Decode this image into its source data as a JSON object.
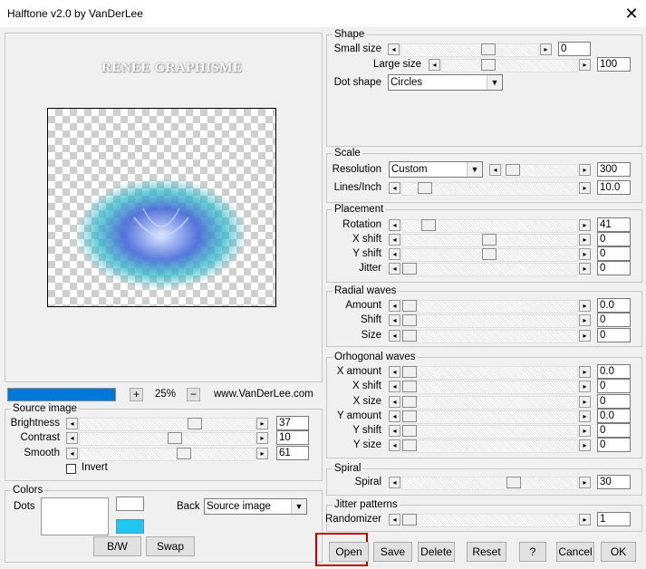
{
  "window": {
    "title": "Halftone v2.0 by VanDerLee",
    "close_icon": "close-icon"
  },
  "preview": {
    "watermark": "RENEE GRAPHISME",
    "zoom": "25%",
    "website": "www.VanDerLee.com",
    "plus": "+",
    "minus": "−",
    "progress": 1.0,
    "accent": "#0078d7"
  },
  "source_image": {
    "title": "Source image",
    "brightness": {
      "label": "Brightness",
      "value": "37"
    },
    "contrast": {
      "label": "Contrast",
      "value": "10"
    },
    "smooth": {
      "label": "Smooth",
      "value": "61"
    },
    "invert": "Invert"
  },
  "colors": {
    "title": "Colors",
    "dots": "Dots",
    "back": "Back",
    "back_value": "Source image",
    "bw": "B/W",
    "swap": "Swap",
    "dot_color": "#ffffff",
    "back_color": "#1ec8f0"
  },
  "shape": {
    "title": "Shape",
    "small_size": {
      "label": "Small size",
      "value": "0"
    },
    "large_size": {
      "label": "Large size",
      "value": "100"
    },
    "dot_shape": {
      "label": "Dot shape",
      "value": "Circles"
    }
  },
  "scale": {
    "title": "Scale",
    "resolution": {
      "label": "Resolution",
      "mode": "Custom",
      "value": "300"
    },
    "lines_inch": {
      "label": "Lines/Inch",
      "value": "10.0"
    }
  },
  "placement": {
    "title": "Placement",
    "rotation": {
      "label": "Rotation",
      "value": "41"
    },
    "x_shift": {
      "label": "X shift",
      "value": "0"
    },
    "y_shift": {
      "label": "Y shift",
      "value": "0"
    },
    "jitter": {
      "label": "Jitter",
      "value": "0"
    }
  },
  "radial_waves": {
    "title": "Radial waves",
    "amount": {
      "label": "Amount",
      "value": "0.0"
    },
    "shift": {
      "label": "Shift",
      "value": "0"
    },
    "size": {
      "label": "Size",
      "value": "0"
    }
  },
  "orthogonal_waves": {
    "title": "Orhogonal waves",
    "x_amount": {
      "label": "X amount",
      "value": "0.0"
    },
    "x_shift": {
      "label": "X shift",
      "value": "0"
    },
    "x_size": {
      "label": "X size",
      "value": "0"
    },
    "y_amount": {
      "label": "Y amount",
      "value": "0.0"
    },
    "y_shift": {
      "label": "Y shift",
      "value": "0"
    },
    "y_size": {
      "label": "Y size",
      "value": "0"
    }
  },
  "spiral": {
    "title": "Spiral",
    "spiral": {
      "label": "Spiral",
      "value": "30"
    }
  },
  "jitter_patterns": {
    "title": "Jitter patterns",
    "randomizer": {
      "label": "Randomizer",
      "value": "1"
    }
  },
  "buttons": {
    "open": "Open",
    "save": "Save",
    "delete": "Delete",
    "reset": "Reset",
    "help": "?",
    "cancel": "Cancel",
    "ok": "OK",
    "highlight": "#c00000"
  }
}
